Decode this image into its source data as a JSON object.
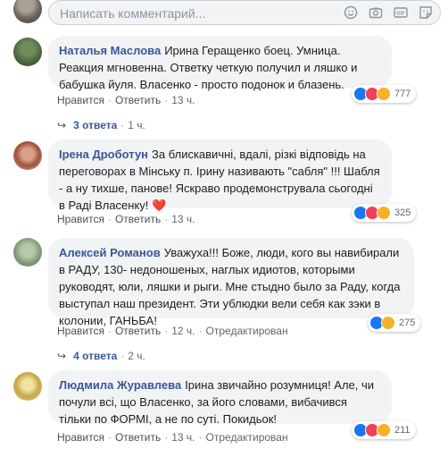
{
  "composer": {
    "placeholder": "Написать комментарий..."
  },
  "comments": [
    {
      "author": "Наталья Маслова",
      "text": "Ирина Геращенко боец. Умница. Реакция мгновенна. Ответку четкую получил и ляшко и бабушка йуля. Власенко - просто подонок и блазень.",
      "like": "Нравится",
      "reply": "Ответить",
      "time": "13 ч.",
      "reactions": "777",
      "replies": {
        "count": "3 ответа",
        "time": "1 ч."
      }
    },
    {
      "author": "Ірена Дроботун",
      "text": "За блискавичні, вдалі, різкі відповідь на переговорах в Мінську п. Ірину називають \"сабля\" !!! Шабля - а ну тихше, панове! Яскраво продемонструвала сьогодні в Раді Власенку!",
      "heart": "❤️",
      "like": "Нравится",
      "reply": "Ответить",
      "time": "13 ч.",
      "reactions": "325"
    },
    {
      "author": "Алексей Романов",
      "text": "Уважуха!!! Боже, люди, кого вы навибирали в РАДУ, 130- недоношеных, наглых идиотов, которыми руководят, юли, ляшки и рыги. Мне стыдно было за Раду, когда выступал наш президент. Эти ублюдки вели себя как зэки в колонии, ГАНЬБА!",
      "like": "Нравится",
      "reply": "Ответить",
      "time": "12 ч.",
      "edited": "Отредактирован",
      "reactions": "275",
      "replies": {
        "count": "4 ответа",
        "time": "2 ч."
      }
    },
    {
      "author": "Людмила Журавлева",
      "text": "Ірина звичайно розумниця! Але, чи почули всі, що Власенко, за його словами, вибачився тільки по ФОРМІ, а не по суті. Покидьок!",
      "like": "Нравится",
      "reply": "Ответить",
      "time": "13 ч.",
      "edited": "Отредактирован",
      "reactions": "211"
    }
  ],
  "colors": {
    "link": "#385898",
    "bubble": "#f2f3f5",
    "like": "#1877f2",
    "love": "#f33e58",
    "haha": "#f7b125"
  }
}
